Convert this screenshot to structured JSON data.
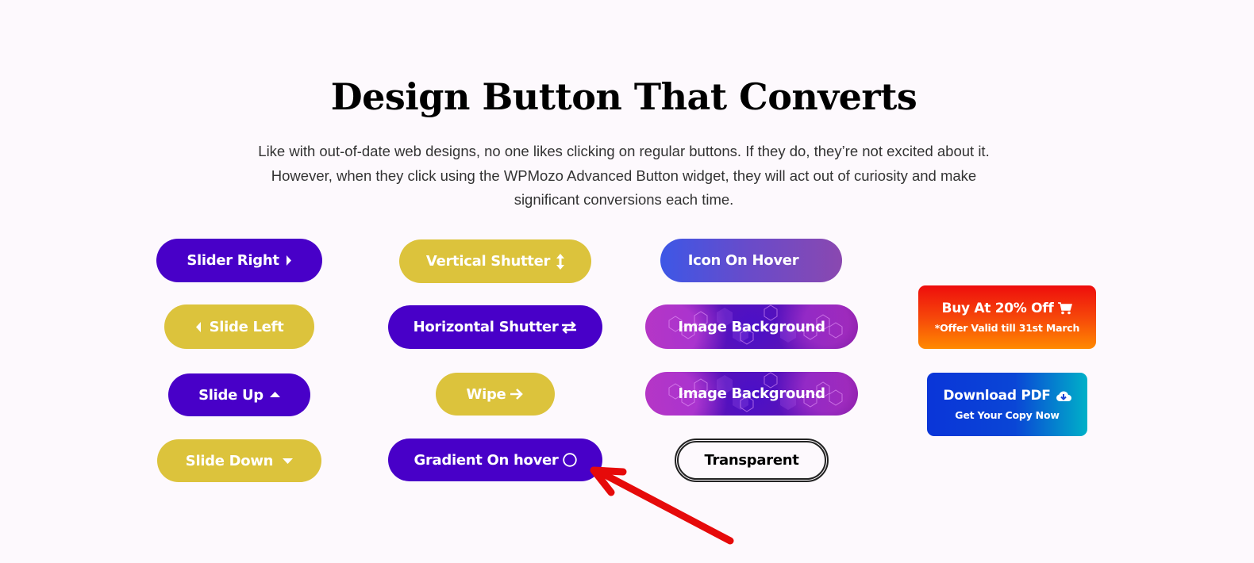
{
  "section": {
    "title": "Design Button That Converts",
    "description": "Like with out-of-date web designs, no one likes clicking on regular buttons. If they do, they’re not excited about it. However, when they click using the WPMozo Advanced Button widget, they will act out of curiosity and make significant conversions each time."
  },
  "colors": {
    "background": "#fdf9fd",
    "purple": "#4800c8",
    "yellow": "#dcc33c",
    "annotation_arrow": "#e60a0a"
  },
  "buttons": {
    "slider_right": {
      "label": "Slider Right",
      "icon": "caret-right-icon"
    },
    "slide_left": {
      "label": "Slide Left",
      "icon": "caret-left-icon"
    },
    "slide_up": {
      "label": "Slide Up",
      "icon": "caret-up-icon"
    },
    "slide_down": {
      "label": "Slide Down",
      "icon": "caret-down-icon"
    },
    "vertical_shutter": {
      "label": "Vertical Shutter",
      "icon": "arrows-vertical-icon"
    },
    "horizontal_shutter": {
      "label": "Horizontal Shutter",
      "icon": "exchange-arrows-icon"
    },
    "wipe": {
      "label": "Wipe",
      "icon": "arrow-right-icon"
    },
    "gradient_on_hover": {
      "label": "Gradient On hover",
      "icon": "circle-icon"
    },
    "icon_on_hover": {
      "label": "Icon On Hover"
    },
    "image_background_1": {
      "label": "Image Background"
    },
    "image_background_2": {
      "label": "Image Background"
    },
    "transparent": {
      "label": "Transparent"
    }
  },
  "cta": {
    "buy": {
      "label": "Buy At 20% Off",
      "sublabel": "*Offer Valid till 31st March",
      "icon": "cart-icon"
    },
    "download": {
      "label": "Download PDF",
      "sublabel": "Get Your Copy Now",
      "icon": "cloud-download-icon"
    }
  }
}
